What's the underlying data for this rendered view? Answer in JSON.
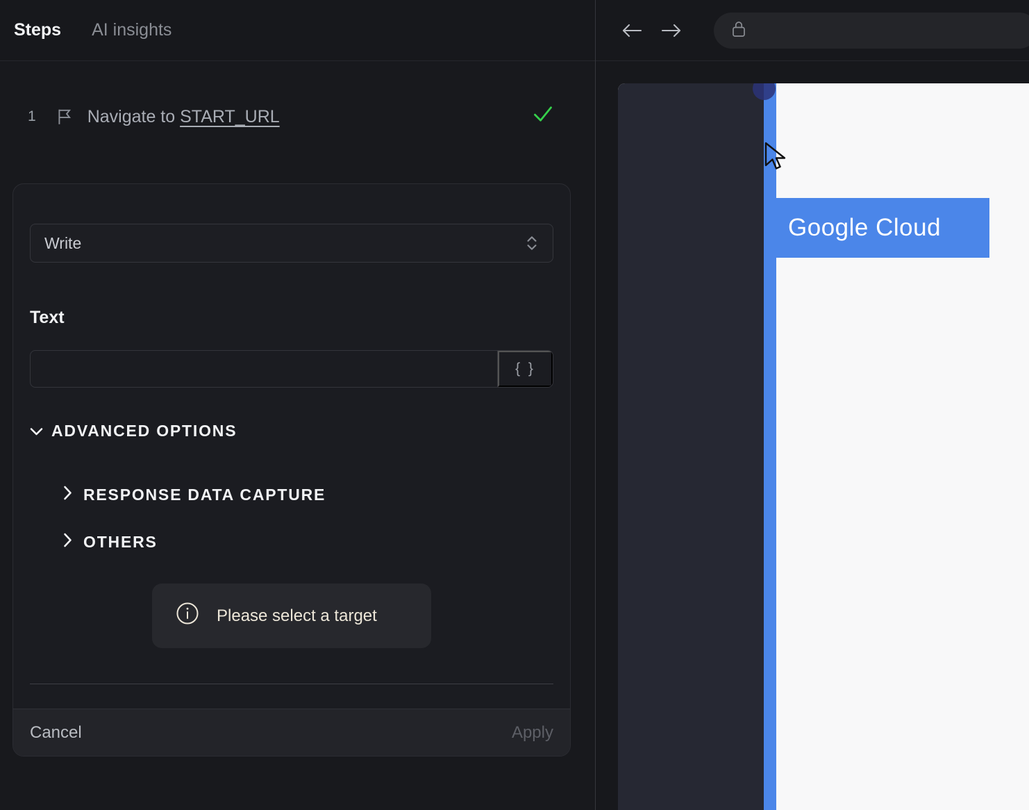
{
  "left_panel": {
    "tabs": {
      "steps": "Steps",
      "ai_insights": "AI insights"
    },
    "step": {
      "number": "1",
      "text": "Navigate to ",
      "link": "START_URL",
      "status": "success"
    },
    "editor": {
      "action_value": "Write",
      "text_label": "Text",
      "text_value": "",
      "text_placeholder": "",
      "braces": "{ }",
      "advanced_options": "ADVANCED OPTIONS",
      "response_capture": "RESPONSE DATA CAPTURE",
      "others": "OTHERS",
      "notice": "Please select a target",
      "cancel": "Cancel",
      "apply": "Apply"
    }
  },
  "right_panel": {
    "page": {
      "highlight_label": "Google Cloud"
    }
  },
  "colors": {
    "highlight_blue": "#4b86e9",
    "success_green": "#35d04b",
    "notice_text": "#ece6d8",
    "panel_bg": "#18191d",
    "navy_panel": "#262833",
    "page_white": "#f8f8f9",
    "click_indicator": "#2c3278"
  },
  "icons": [
    "flag-icon",
    "check-icon",
    "select-chevrons-icon",
    "braces-icon",
    "chevron-down-icon",
    "chevron-right-icon",
    "info-icon",
    "back-arrow-icon",
    "forward-arrow-icon",
    "lock-icon",
    "cursor-icon",
    "click-indicator"
  ]
}
